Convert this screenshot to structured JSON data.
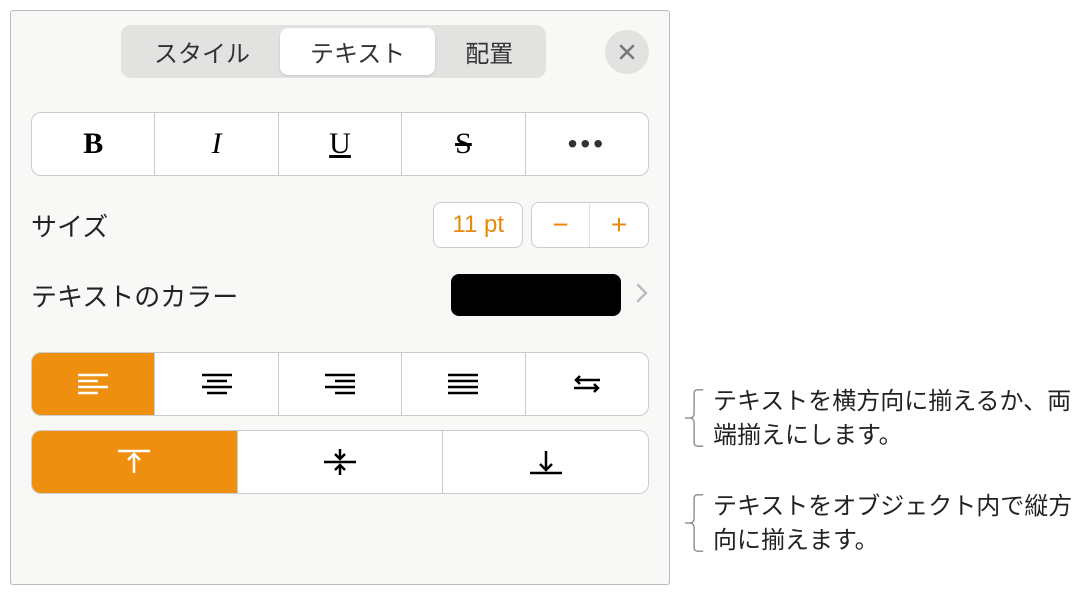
{
  "tabs": {
    "style": "スタイル",
    "text": "テキスト",
    "arrange": "配置"
  },
  "format": {
    "bold": "B",
    "italic": "I",
    "underline": "U",
    "strike": "S",
    "more": "•••"
  },
  "size": {
    "label": "サイズ",
    "value": "11 pt",
    "minus": "−",
    "plus": "+"
  },
  "color": {
    "label": "テキストのカラー",
    "value": "#000000"
  },
  "annotations": {
    "horizontal": "テキストを横方向に揃えるか、両端揃えにします。",
    "vertical": "テキストをオブジェクト内で縦方向に揃えます。"
  }
}
